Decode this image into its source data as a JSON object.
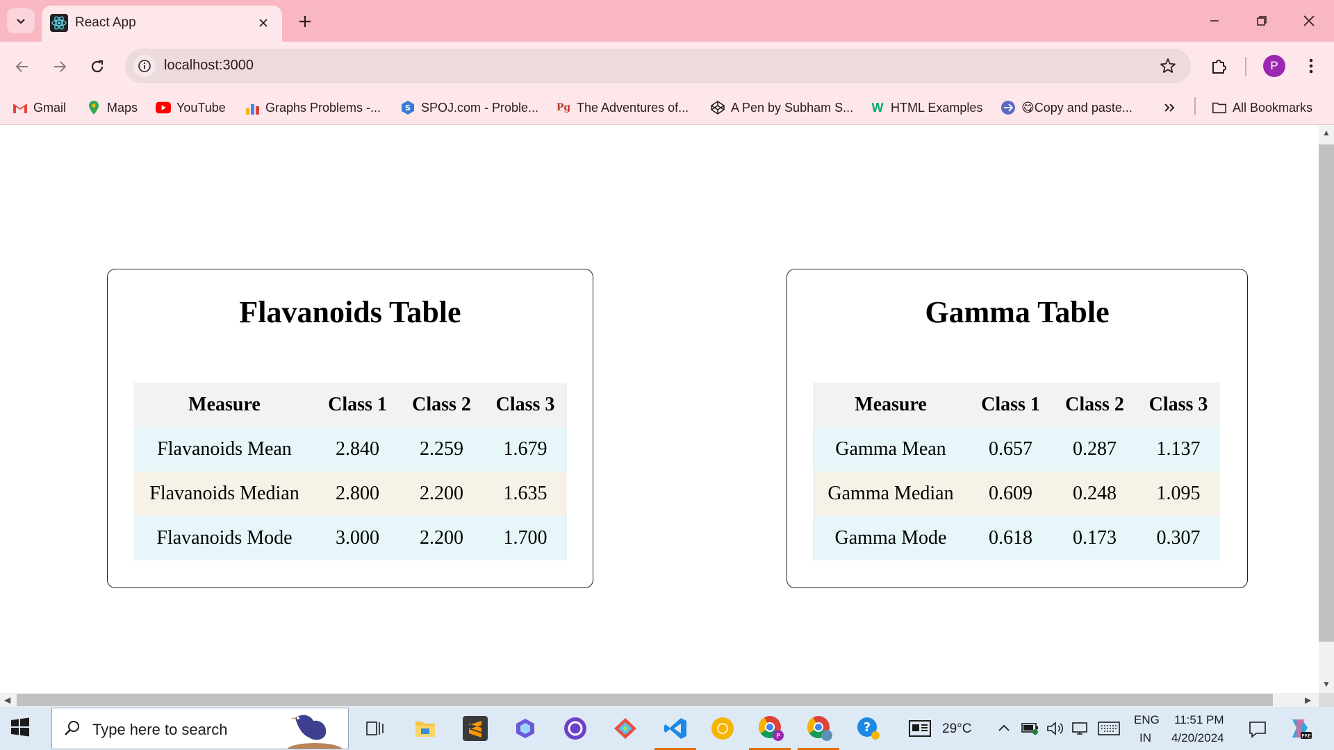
{
  "browser": {
    "tab_title": "React App",
    "url": "localhost:3000",
    "avatar_letter": "P",
    "bookmarks": [
      {
        "label": "Gmail",
        "icon": "gmail-icon"
      },
      {
        "label": "Maps",
        "icon": "maps-icon"
      },
      {
        "label": "YouTube",
        "icon": "youtube-icon"
      },
      {
        "label": "Graphs Problems -...",
        "icon": "graphs-icon"
      },
      {
        "label": "SPOJ.com - Proble...",
        "icon": "spoj-icon"
      },
      {
        "label": "The Adventures of...",
        "icon": "pg-icon"
      },
      {
        "label": "A Pen by Subham S...",
        "icon": "codepen-icon"
      },
      {
        "label": "HTML Examples",
        "icon": "w3schools-icon"
      },
      {
        "label": "😋Copy and paste...",
        "icon": "copy-paste-icon"
      }
    ],
    "all_bookmarks": "All Bookmarks",
    "accent": "#f9b7c3"
  },
  "tables": [
    {
      "title": "Flavanoids Table",
      "headers": [
        "Measure",
        "Class 1",
        "Class 2",
        "Class 3"
      ],
      "rows": [
        [
          "Flavanoids Mean",
          "2.840",
          "2.259",
          "1.679"
        ],
        [
          "Flavanoids Median",
          "2.800",
          "2.200",
          "1.635"
        ],
        [
          "Flavanoids Mode",
          "3.000",
          "2.200",
          "1.700"
        ]
      ]
    },
    {
      "title": "Gamma Table",
      "headers": [
        "Measure",
        "Class 1",
        "Class 2",
        "Class 3"
      ],
      "rows": [
        [
          "Gamma Mean",
          "0.657",
          "0.287",
          "1.137"
        ],
        [
          "Gamma Median",
          "0.609",
          "0.248",
          "1.095"
        ],
        [
          "Gamma Mode",
          "0.618",
          "0.173",
          "0.307"
        ]
      ]
    }
  ],
  "taskbar": {
    "search_placeholder": "Type here to search",
    "weather": "29°C",
    "language": "ENG",
    "region": "IN",
    "time": "11:51 PM",
    "date": "4/20/2024"
  }
}
